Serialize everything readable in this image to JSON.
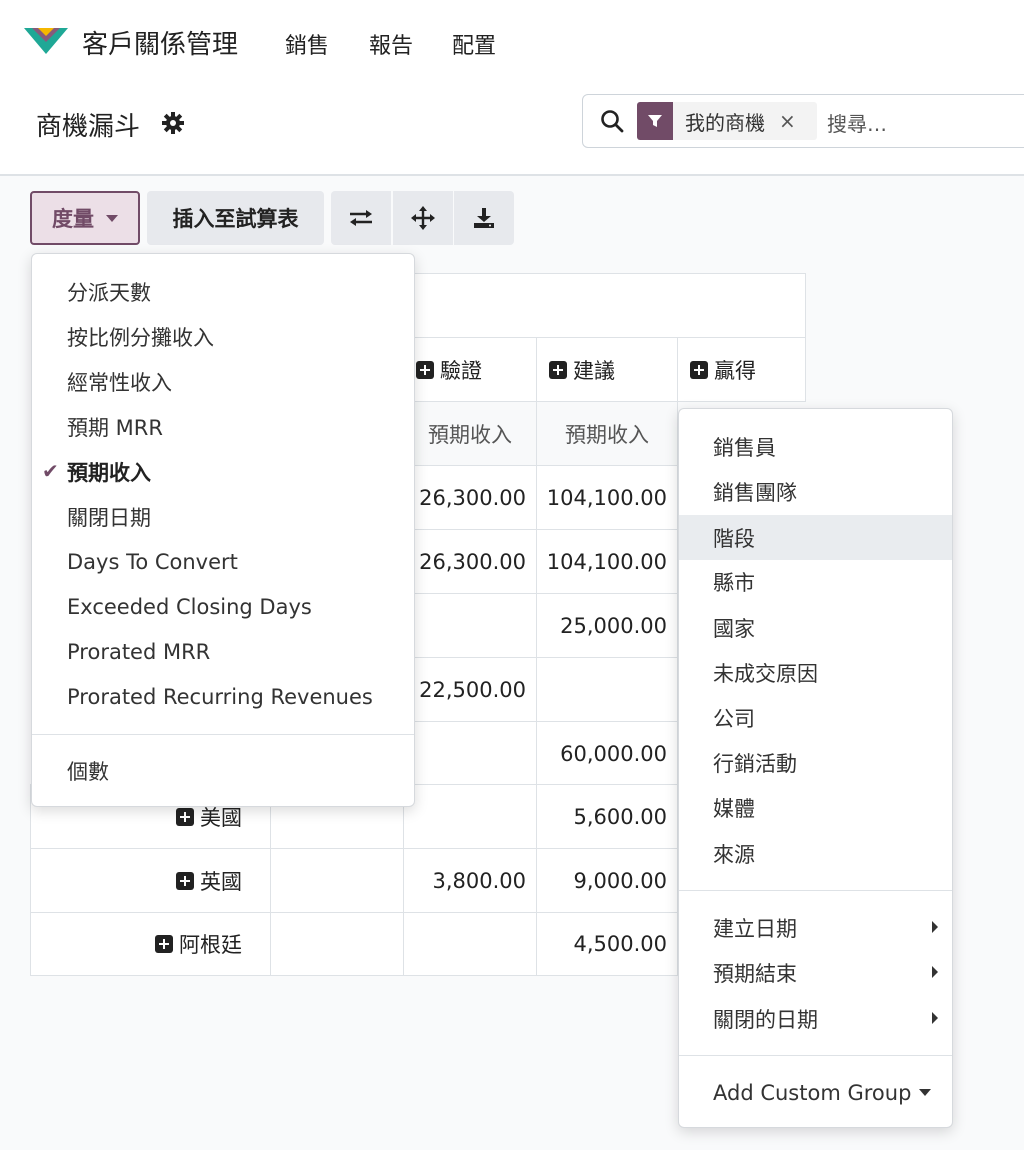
{
  "nav": {
    "app_name": "客戶關係管理",
    "items": [
      "銷售",
      "報告",
      "配置"
    ]
  },
  "control_panel": {
    "title": "商機漏斗",
    "search": {
      "facet_label": "我的商機",
      "facet_remove": "×",
      "placeholder": "搜尋…"
    }
  },
  "toolbar": {
    "measures_label": "度量",
    "insert_label": "插入至試算表",
    "flip_icon": "⇄",
    "expand_icon": "✥",
    "download_icon": "download-icon"
  },
  "pivot": {
    "col_headers": [
      "驗證",
      "建議",
      "贏得"
    ],
    "measure_label": "預期收入",
    "rows": [
      {
        "label": "",
        "values": [
          "26,300.00",
          "104,100.00"
        ]
      },
      {
        "label": "",
        "values": [
          "26,300.00",
          "104,100.00"
        ]
      },
      {
        "label": "",
        "values": [
          "",
          "25,000.00"
        ]
      },
      {
        "label": "",
        "values": [
          "22,500.00",
          ""
        ]
      },
      {
        "label": "",
        "values": [
          "",
          "60,000.00"
        ]
      },
      {
        "label": "美國",
        "values": [
          "",
          "5,600.00"
        ]
      },
      {
        "label": "英國",
        "values": [
          "3,800.00",
          "9,000.00"
        ]
      },
      {
        "label": "阿根廷",
        "values": [
          "",
          "4,500.00"
        ]
      }
    ]
  },
  "measures_menu": {
    "items": [
      "分派天數",
      "按比例分攤收入",
      "經常性收入",
      "預期 MRR",
      "預期收入",
      "關閉日期",
      "Days To Convert",
      "Exceeded Closing Days",
      "Prorated MRR",
      "Prorated Recurring Revenues"
    ],
    "selected_index": 4,
    "count_label": "個數"
  },
  "groupby_menu": {
    "items": [
      "銷售員",
      "銷售團隊",
      "階段",
      "縣市",
      "國家",
      "未成交原因",
      "公司",
      "行銷活動",
      "媒體",
      "來源"
    ],
    "active_index": 2,
    "date_items": [
      "建立日期",
      "預期結束",
      "關閉的日期"
    ],
    "custom_label": "Add Custom Group"
  },
  "colors": {
    "accent": "#714b67",
    "accent_light": "#ecdfe7",
    "button_bg": "#e7e9ed"
  }
}
